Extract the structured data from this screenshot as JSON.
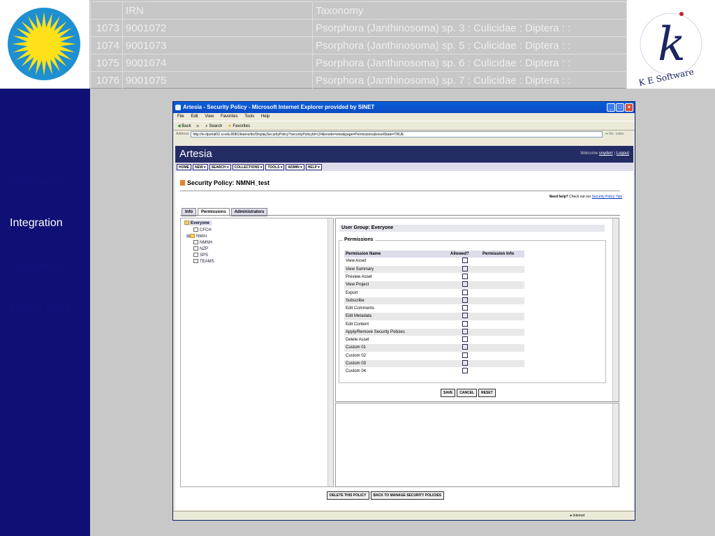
{
  "top_table": {
    "header": {
      "num": "",
      "irn": "IRN",
      "taxonomy": "Taxonomy"
    },
    "rows": [
      {
        "num": "1073",
        "irn": "9001072",
        "taxonomy": "Psorphora (Janthinosoma) sp. 3 : Culicidae : Diptera : :"
      },
      {
        "num": "1074",
        "irn": "9001073",
        "taxonomy": "Psorphora (Janthinosoma) sp. 5 : Culicidae : Diptera : :"
      },
      {
        "num": "1075",
        "irn": "9001074",
        "taxonomy": "Psorphora (Janthinosoma) sp. 6 : Culicidae : Diptera : :"
      },
      {
        "num": "1076",
        "irn": "9001075",
        "taxonomy": "Psorphora (Janthinosoma) sp. 7 : Culicidae : Diptera : :"
      }
    ]
  },
  "ke_logo": {
    "letter": "k",
    "ring_text": "K E  Software"
  },
  "sidebar": {
    "items": [
      {
        "label": "Automation",
        "active": false
      },
      {
        "label": "Integration",
        "active": true
      },
      {
        "label": "Challenges",
        "active": false
      },
      {
        "label": "Future Work",
        "active": false
      }
    ]
  },
  "browser": {
    "title": "Artesia - Security Policy - Microsoft Internet Explorer provided by SINET",
    "menu": [
      "File",
      "Edit",
      "View",
      "Favorites",
      "Tools",
      "Help"
    ],
    "toolbar": {
      "back": "Back",
      "search": "Search",
      "favorites": "Favorites"
    },
    "address_label": "Address",
    "url": "http://si-dportal02.si.edu:8081/teams/do/DisplaySecurityPolicy?securityPolicyId=124&mode=view&page=Permissions&resetState=TRUE",
    "go": "Go",
    "links": "Links",
    "status_zone": "Internet"
  },
  "app": {
    "brand": "Artesia",
    "welcome": "Welcome",
    "user": "snyderr",
    "logout": "Logout",
    "nav": [
      "HOME",
      "NEW ▾",
      "SEARCH ▾",
      "COLLECTIONS ▾",
      "TOOLS ▾",
      "ADMIN ▾",
      "HELP ▾"
    ],
    "page_title": "Security Policy: NMNH_test",
    "help_prefix": "Need help?",
    "help_text": "Check out our",
    "help_link": "Security Policy Tips",
    "tabs": [
      "Info",
      "Permissions",
      "Administrators"
    ],
    "tree": [
      "Everyone",
      "CFCH",
      "NMAI",
      "NMNH",
      "NZP",
      "SPS",
      "TEAMS"
    ],
    "user_group_label": "User Group:",
    "user_group_value": "Everyone",
    "permissions_legend": "Permissions",
    "columns": [
      "Permission Name",
      "Allowed?",
      "Permission Info"
    ],
    "permissions": [
      "View Asset",
      "View Summary",
      "Preview Asset",
      "View Project",
      "Export",
      "Subscribe",
      "Edit Comments",
      "Edit Metadata",
      "Edit Content",
      "Apply/Remove Security Policies",
      "Delete Asset",
      "Custom 01",
      "Custom 02",
      "Custom 03",
      "Custom 04"
    ],
    "buttons": {
      "save": "SAVE",
      "cancel": "CANCEL",
      "reset": "RESET",
      "delete_policy": "DELETE THIS POLICY",
      "back_to_manage": "BACK TO MANAGE SECURITY POLICIES"
    }
  },
  "colors": {
    "sidebar": "#0f0f75",
    "banner": "#242c64",
    "sun": "#ffe11a",
    "sun_bg": "#1e8fd0"
  }
}
